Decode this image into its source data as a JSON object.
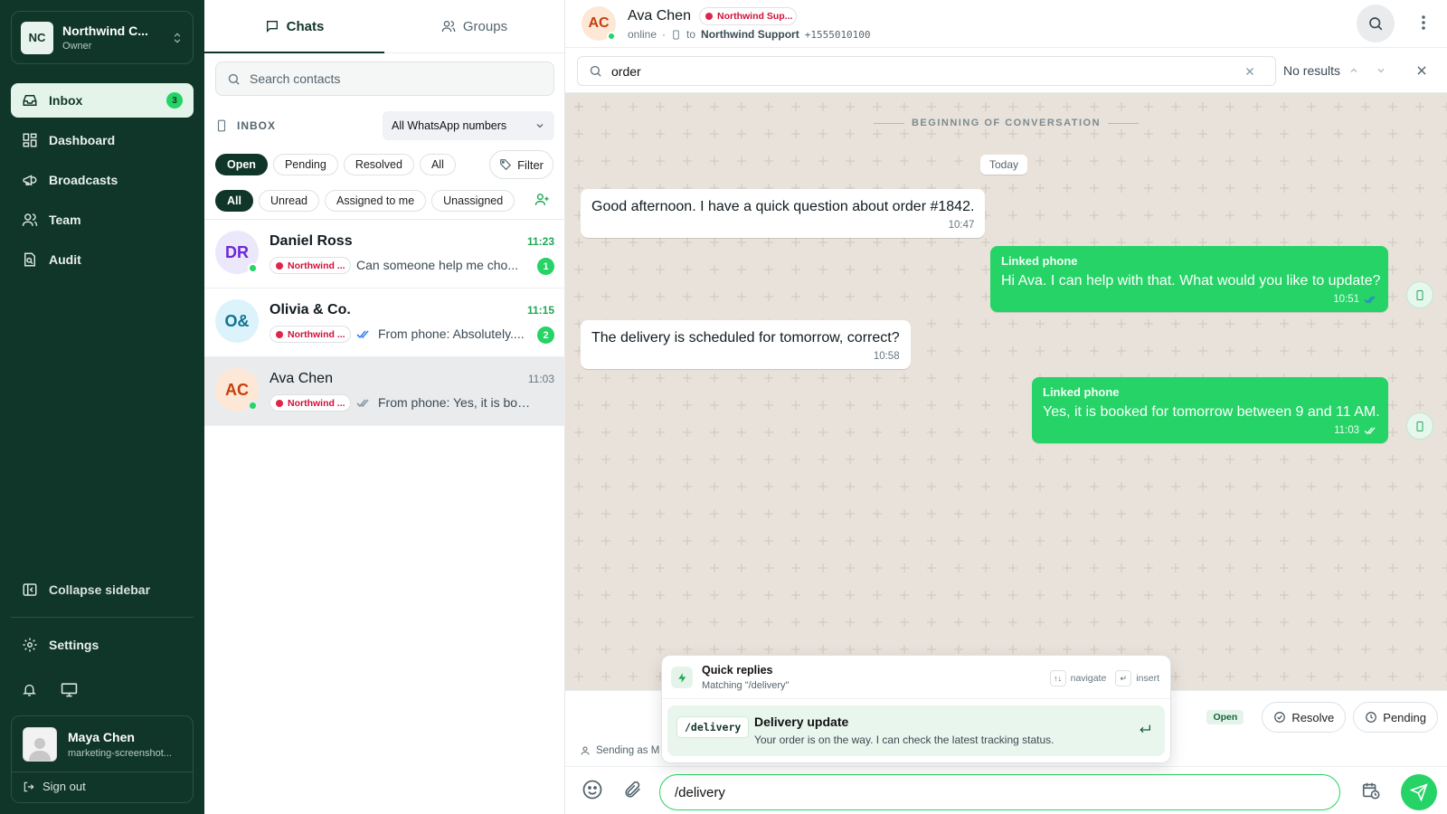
{
  "workspace": {
    "initials": "NC",
    "name": "Northwind C...",
    "role": "Owner"
  },
  "nav": {
    "items": [
      {
        "label": "Inbox",
        "icon": "inbox-icon",
        "badge": "3",
        "active": true
      },
      {
        "label": "Dashboard",
        "icon": "dashboard-icon"
      },
      {
        "label": "Broadcasts",
        "icon": "megaphone-icon"
      },
      {
        "label": "Team",
        "icon": "users-icon"
      },
      {
        "label": "Audit",
        "icon": "audit-icon"
      }
    ],
    "collapse_label": "Collapse sidebar",
    "settings_label": "Settings"
  },
  "user": {
    "name": "Maya Chen",
    "email": "marketing-screenshot...",
    "signout_label": "Sign out"
  },
  "list": {
    "tabs": [
      {
        "label": "Chats",
        "active": true
      },
      {
        "label": "Groups"
      }
    ],
    "search_placeholder": "Search contacts",
    "inbox_label": "INBOX",
    "number_select": "All WhatsApp numbers",
    "status_filters": [
      "Open",
      "Pending",
      "Resolved",
      "All"
    ],
    "filter_label": "Filter",
    "assign_filters": [
      "All",
      "Unread",
      "Assigned to me",
      "Unassigned"
    ],
    "conversations": [
      {
        "initials": "DR",
        "name": "Daniel Ross",
        "time": "11:23",
        "tag": "Northwind ...",
        "preview": "Can someone help me cho...",
        "unread": "1",
        "online": true
      },
      {
        "initials": "O&",
        "name": "Olivia & Co.",
        "time": "11:15",
        "tag": "Northwind ...",
        "preview": "From phone: Absolutely....",
        "unread": "2",
        "online": false
      },
      {
        "initials": "AC",
        "name": "Ava Chen",
        "time": "11:03",
        "tag": "Northwind ...",
        "preview": "From phone: Yes, it is book...",
        "unread": "",
        "online": true
      }
    ]
  },
  "chat": {
    "contact": {
      "initials": "AC",
      "name": "Ava Chen",
      "tag": "Northwind Sup...",
      "status": "online",
      "to_label": "to",
      "channel": "Northwind Support",
      "number": "+1555010100"
    },
    "find": {
      "query": "order",
      "status": "No results"
    },
    "beginning_label": "BEGINNING OF CONVERSATION",
    "day_label": "Today",
    "messages": [
      {
        "dir": "in",
        "text": "Good afternoon. I have a quick question about order #1842.",
        "time": "10:47"
      },
      {
        "dir": "out",
        "sender": "Linked phone",
        "text": "Hi Ava. I can help with that. What would you like to update?",
        "time": "10:51"
      },
      {
        "dir": "in",
        "text": "The delivery is scheduled for tomorrow, correct?",
        "time": "10:58"
      },
      {
        "dir": "out",
        "sender": "Linked phone",
        "text": "Yes, it is booked for tomorrow between 9 and 11 AM.",
        "time": "11:03"
      }
    ],
    "status_chip": "Open",
    "resolve_label": "Resolve",
    "pending_label": "Pending",
    "sending_as": "Sending as M",
    "composer_value": "/delivery"
  },
  "quick_replies": {
    "title": "Quick replies",
    "subtitle": "Matching \"/delivery\"",
    "hint_navigate_key": "↑↓",
    "hint_navigate": "navigate",
    "hint_insert_key": "↵",
    "hint_insert": "insert",
    "item": {
      "shortcut": "/delivery",
      "name": "Delivery update",
      "body": "Your order is on the way. I can check the latest tracking status."
    }
  },
  "colors": {
    "sidebar": "#103529",
    "accent": "#25d366",
    "chat_bg": "#e8e2da",
    "tag_red": "#e0244a"
  }
}
